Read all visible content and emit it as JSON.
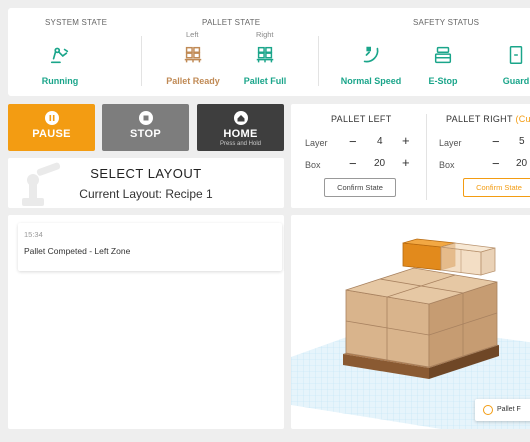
{
  "status_bar": {
    "system_state": {
      "title": "SYSTEM STATE",
      "item": {
        "label": "Running",
        "icon": "robot-arm-icon"
      }
    },
    "pallet_state": {
      "title": "PALLET STATE",
      "left_label": "Left",
      "right_label": "Right",
      "left": {
        "label": "Pallet Ready",
        "icon": "pallet-stack-icon"
      },
      "right": {
        "label": "Pallet Full",
        "icon": "pallet-full-icon"
      }
    },
    "safety_status": {
      "title": "SAFETY STATUS",
      "items": [
        {
          "label": "Normal Speed",
          "icon": "speed-gauge-icon"
        },
        {
          "label": "E-Stop",
          "icon": "estop-icon"
        },
        {
          "label": "Guard",
          "icon": "guard-icon"
        }
      ]
    }
  },
  "controls": {
    "pause": {
      "label": "PAUSE",
      "icon": "pause-icon"
    },
    "stop": {
      "label": "STOP",
      "icon": "stop-icon"
    },
    "home": {
      "label": "HOME",
      "sub": "Press and Hold",
      "icon": "home-icon"
    }
  },
  "layout": {
    "title": "SELECT LAYOUT",
    "current": "Current Layout: Recipe 1"
  },
  "pallet_left": {
    "title": "PALLET LEFT",
    "layer_label": "Layer",
    "layer_value": "4",
    "box_label": "Box",
    "box_value": "20",
    "confirm": "Confirm State"
  },
  "pallet_right": {
    "title": "PALLET RIGHT",
    "title_suffix": "(Cur",
    "layer_label": "Layer",
    "layer_value": "5",
    "box_label": "Box",
    "box_value": "20",
    "confirm": "Confirm State"
  },
  "log": {
    "entries": [
      {
        "time": "15:34",
        "message": "Pallet Competed - Left Zone"
      }
    ]
  },
  "view3d": {
    "button_label": "Pallet F"
  },
  "colors": {
    "accent": "#f39c12",
    "status_green": "#1aa58a",
    "pallet_tan": "#c08a55"
  }
}
